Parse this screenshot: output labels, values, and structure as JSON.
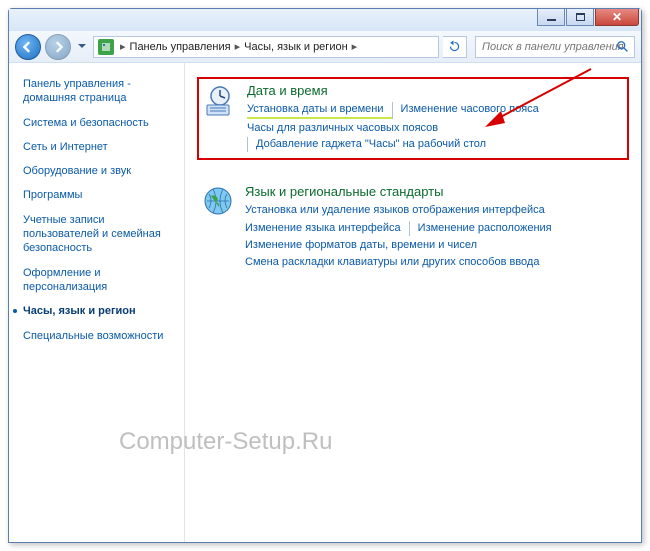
{
  "titlebar": {
    "min_name": "minimize",
    "max_name": "maximize",
    "close_name": "close"
  },
  "nav": {
    "crumb1": "Панель управления",
    "crumb2": "Часы, язык и регион",
    "search_placeholder": "Поиск в панели управления"
  },
  "sidebar": {
    "items": [
      {
        "label": "Панель управления - домашняя страница",
        "active": false
      },
      {
        "label": "Система и безопасность",
        "active": false
      },
      {
        "label": "Сеть и Интернет",
        "active": false
      },
      {
        "label": "Оборудование и звук",
        "active": false
      },
      {
        "label": "Программы",
        "active": false
      },
      {
        "label": "Учетные записи пользователей и семейная безопасность",
        "active": false
      },
      {
        "label": "Оформление и персонализация",
        "active": false
      },
      {
        "label": "Часы, язык и регион",
        "active": true
      },
      {
        "label": "Специальные возможности",
        "active": false
      }
    ]
  },
  "main": {
    "category1": {
      "title": "Дата и время",
      "links_row1": [
        "Установка даты и времени",
        "Изменение часового пояса"
      ],
      "links_row2": [
        "Часы для различных часовых поясов",
        "Добавление гаджета \"Часы\" на рабочий стол"
      ]
    },
    "category2": {
      "title": "Язык и региональные стандарты",
      "links": [
        "Установка или удаление языков отображения интерфейса",
        "Изменение языка интерфейса",
        "Изменение расположения",
        "Изменение форматов даты, времени и чисел",
        "Смена раскладки клавиатуры или других способов ввода"
      ]
    }
  },
  "watermark": "Computer-Setup.Ru"
}
